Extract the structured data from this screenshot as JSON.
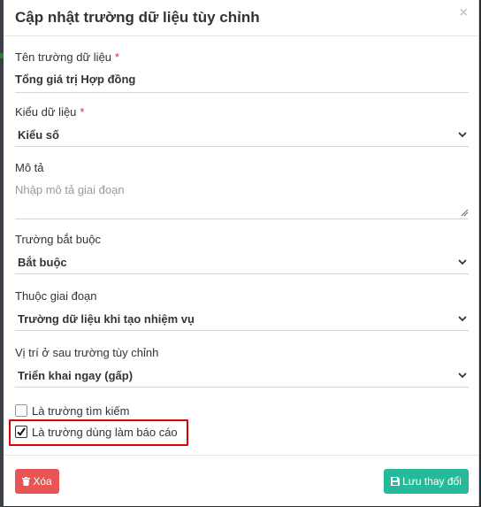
{
  "modal": {
    "title": "Cập nhật trường dữ liệu tùy chỉnh",
    "close_symbol": "×"
  },
  "fields": {
    "field_name": {
      "label": "Tên trường dữ liệu",
      "required_mark": "*",
      "value": "Tổng giá trị Hợp đồng"
    },
    "data_type": {
      "label": "Kiểu dữ liệu",
      "required_mark": "*",
      "value": "Kiểu số"
    },
    "description": {
      "label": "Mô tả",
      "placeholder": "Nhập mô tả giai đoạn"
    },
    "required_field": {
      "label": "Trường bắt buộc",
      "value": "Bắt buộc"
    },
    "stage": {
      "label": "Thuộc giai đoạn",
      "value": "Trường dữ liệu khi tạo nhiệm vụ"
    },
    "position": {
      "label": "Vị trí ở sau trường tùy chỉnh",
      "value": "Triển khai ngay (gấp)"
    }
  },
  "checkboxes": {
    "search_field": {
      "label": "Là trường tìm kiếm",
      "checked": false
    },
    "report_field": {
      "label": "Là trường dùng làm báo cáo",
      "checked": true
    }
  },
  "footer": {
    "delete_label": "Xóa",
    "save_label": "Lưu thay đổi"
  },
  "colors": {
    "delete_button": "#e95454",
    "save_button": "#26b99a",
    "required": "#d32f2f",
    "highlight": "#e00000"
  },
  "icons": {
    "close": "close-icon",
    "chevron": "chevron-down-icon",
    "delete": "trash-icon",
    "save": "floppy-disk-icon",
    "check": "checkmark-icon"
  }
}
